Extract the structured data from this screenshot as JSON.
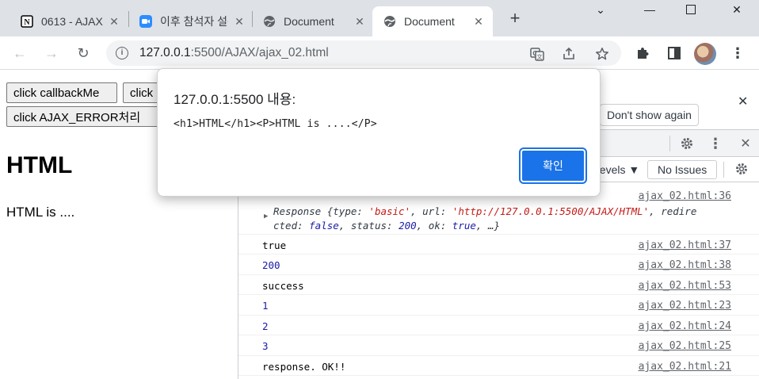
{
  "tabs": [
    {
      "title": "0613 - AJAX",
      "icon": "notion-icon",
      "active": false
    },
    {
      "title": "이후 참석자 설문",
      "icon": "zoom-icon",
      "active": false
    },
    {
      "title": "Document",
      "icon": "globe-icon",
      "active": false
    },
    {
      "title": "Document",
      "icon": "globe-icon",
      "active": true
    }
  ],
  "toolbar": {
    "url_host": "127.0.0.1",
    "url_rest": ":5500/AJAX/ajax_02.html"
  },
  "page": {
    "buttons": [
      "click callbackMe",
      "click",
      "click AJAX_ERROR처리"
    ],
    "heading": "HTML",
    "paragraph": "HTML is ...."
  },
  "devtools": {
    "dont_show_again": "Don't show again",
    "levels": "Levels ▼",
    "no_issues": "No Issues",
    "logs": [
      {
        "src": "ajax_02.html:36",
        "type": "object",
        "obj_line1": [
          "Response {",
          "type: ",
          "'basic'",
          ", url: ",
          "'http://127.0.0.1:5500/AJAX/HTML'",
          ", redire"
        ],
        "obj_line2": [
          "cted: ",
          "false",
          ", status: ",
          "200",
          ", ok: ",
          "true",
          ", …}"
        ]
      },
      {
        "msg": "true",
        "src": "ajax_02.html:37",
        "style": "plain"
      },
      {
        "msg": "200",
        "src": "ajax_02.html:38",
        "style": "blue"
      },
      {
        "msg": "success",
        "src": "ajax_02.html:53",
        "style": "plain"
      },
      {
        "msg": "1",
        "src": "ajax_02.html:23",
        "style": "blue"
      },
      {
        "msg": "2",
        "src": "ajax_02.html:24",
        "style": "blue"
      },
      {
        "msg": "3",
        "src": "ajax_02.html:25",
        "style": "blue"
      },
      {
        "msg": "response. OK!!",
        "src": "ajax_02.html:21",
        "style": "plain"
      }
    ]
  },
  "dialog": {
    "title": "127.0.0.1:5500 내용:",
    "message": "<h1>HTML</h1><P>HTML is ....</P>",
    "ok_label": "확인"
  },
  "colors": {
    "accent": "#1a73e8",
    "tabstrip": "#dee1e6",
    "console_number": "#1a1aa6",
    "console_string": "#c41a16"
  }
}
